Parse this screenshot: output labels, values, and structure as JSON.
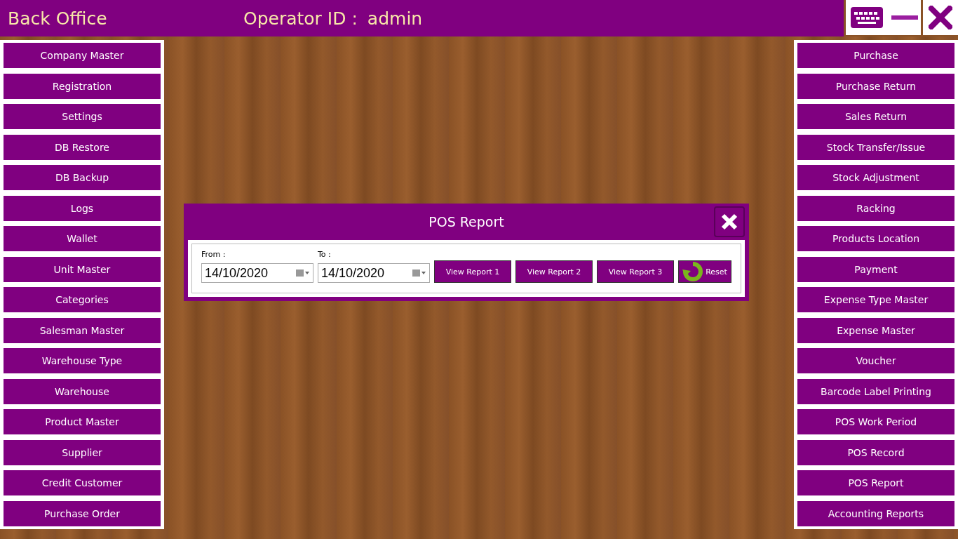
{
  "header": {
    "title": "Back Office",
    "operator_label": "Operator ID :",
    "operator": "admin"
  },
  "left_menu": [
    "Company Master",
    "Registration",
    "Settings",
    "DB Restore",
    "DB Backup",
    "Logs",
    "Wallet",
    "Unit Master",
    "Categories",
    "Salesman Master",
    "Warehouse Type",
    "Warehouse",
    "Product Master",
    "Supplier",
    "Credit Customer",
    "Purchase Order"
  ],
  "right_menu": [
    "Purchase",
    "Purchase Return",
    "Sales Return",
    "Stock Transfer/Issue",
    "Stock Adjustment",
    "Racking",
    "Products Location",
    "Payment",
    "Expense Type Master",
    "Expense Master",
    "Voucher",
    "Barcode Label Printing",
    "POS Work Period",
    "POS Record",
    "POS Report",
    "Accounting Reports"
  ],
  "dialog": {
    "title": "POS Report",
    "from_label": "From :",
    "from_value": "14/10/2020",
    "to_label": "To :",
    "to_value": "14/10/2020",
    "buttons": [
      "View Report 1",
      "View Report 2",
      "View Report 3"
    ],
    "reset": "Reset"
  }
}
